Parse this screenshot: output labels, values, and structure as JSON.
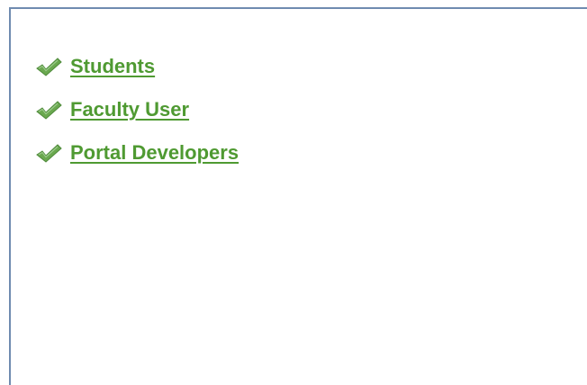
{
  "items": [
    {
      "label": "Students",
      "icon": "check-icon"
    },
    {
      "label": "Faculty User",
      "icon": "check-icon"
    },
    {
      "label": "Portal Developers",
      "icon": "check-icon"
    }
  ],
  "colors": {
    "link": "#4f9a32",
    "check": "#6aa84f",
    "border": "#6f8bb0"
  }
}
